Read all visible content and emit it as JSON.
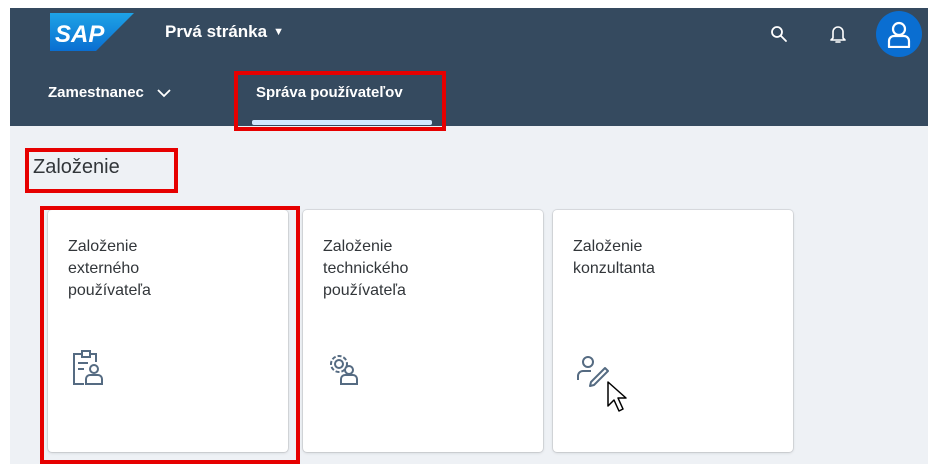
{
  "header": {
    "logo_text": "SAP",
    "app_title": "Prvá stránka",
    "icons": [
      "search-icon",
      "bell-icon",
      "user-icon"
    ]
  },
  "tabs": [
    {
      "label": "Zamestnanec",
      "has_dropdown": true
    },
    {
      "label": "Správa používateľov",
      "selected": true
    }
  ],
  "section": {
    "title": "Založenie"
  },
  "tiles": [
    {
      "title": "Založenie\nexterného\npoužívateľa",
      "icon": "clipboard-user-icon"
    },
    {
      "title": "Založenie\ntechnického\npoužívateľa",
      "icon": "gear-user-icon"
    },
    {
      "title": "Založenie\nkonzultanta",
      "icon": "user-edit-icon"
    }
  ],
  "colors": {
    "shell": "#354a5f",
    "highlight": "#e60000",
    "avatar": "#0a6ed1",
    "background": "#eef1f5"
  }
}
